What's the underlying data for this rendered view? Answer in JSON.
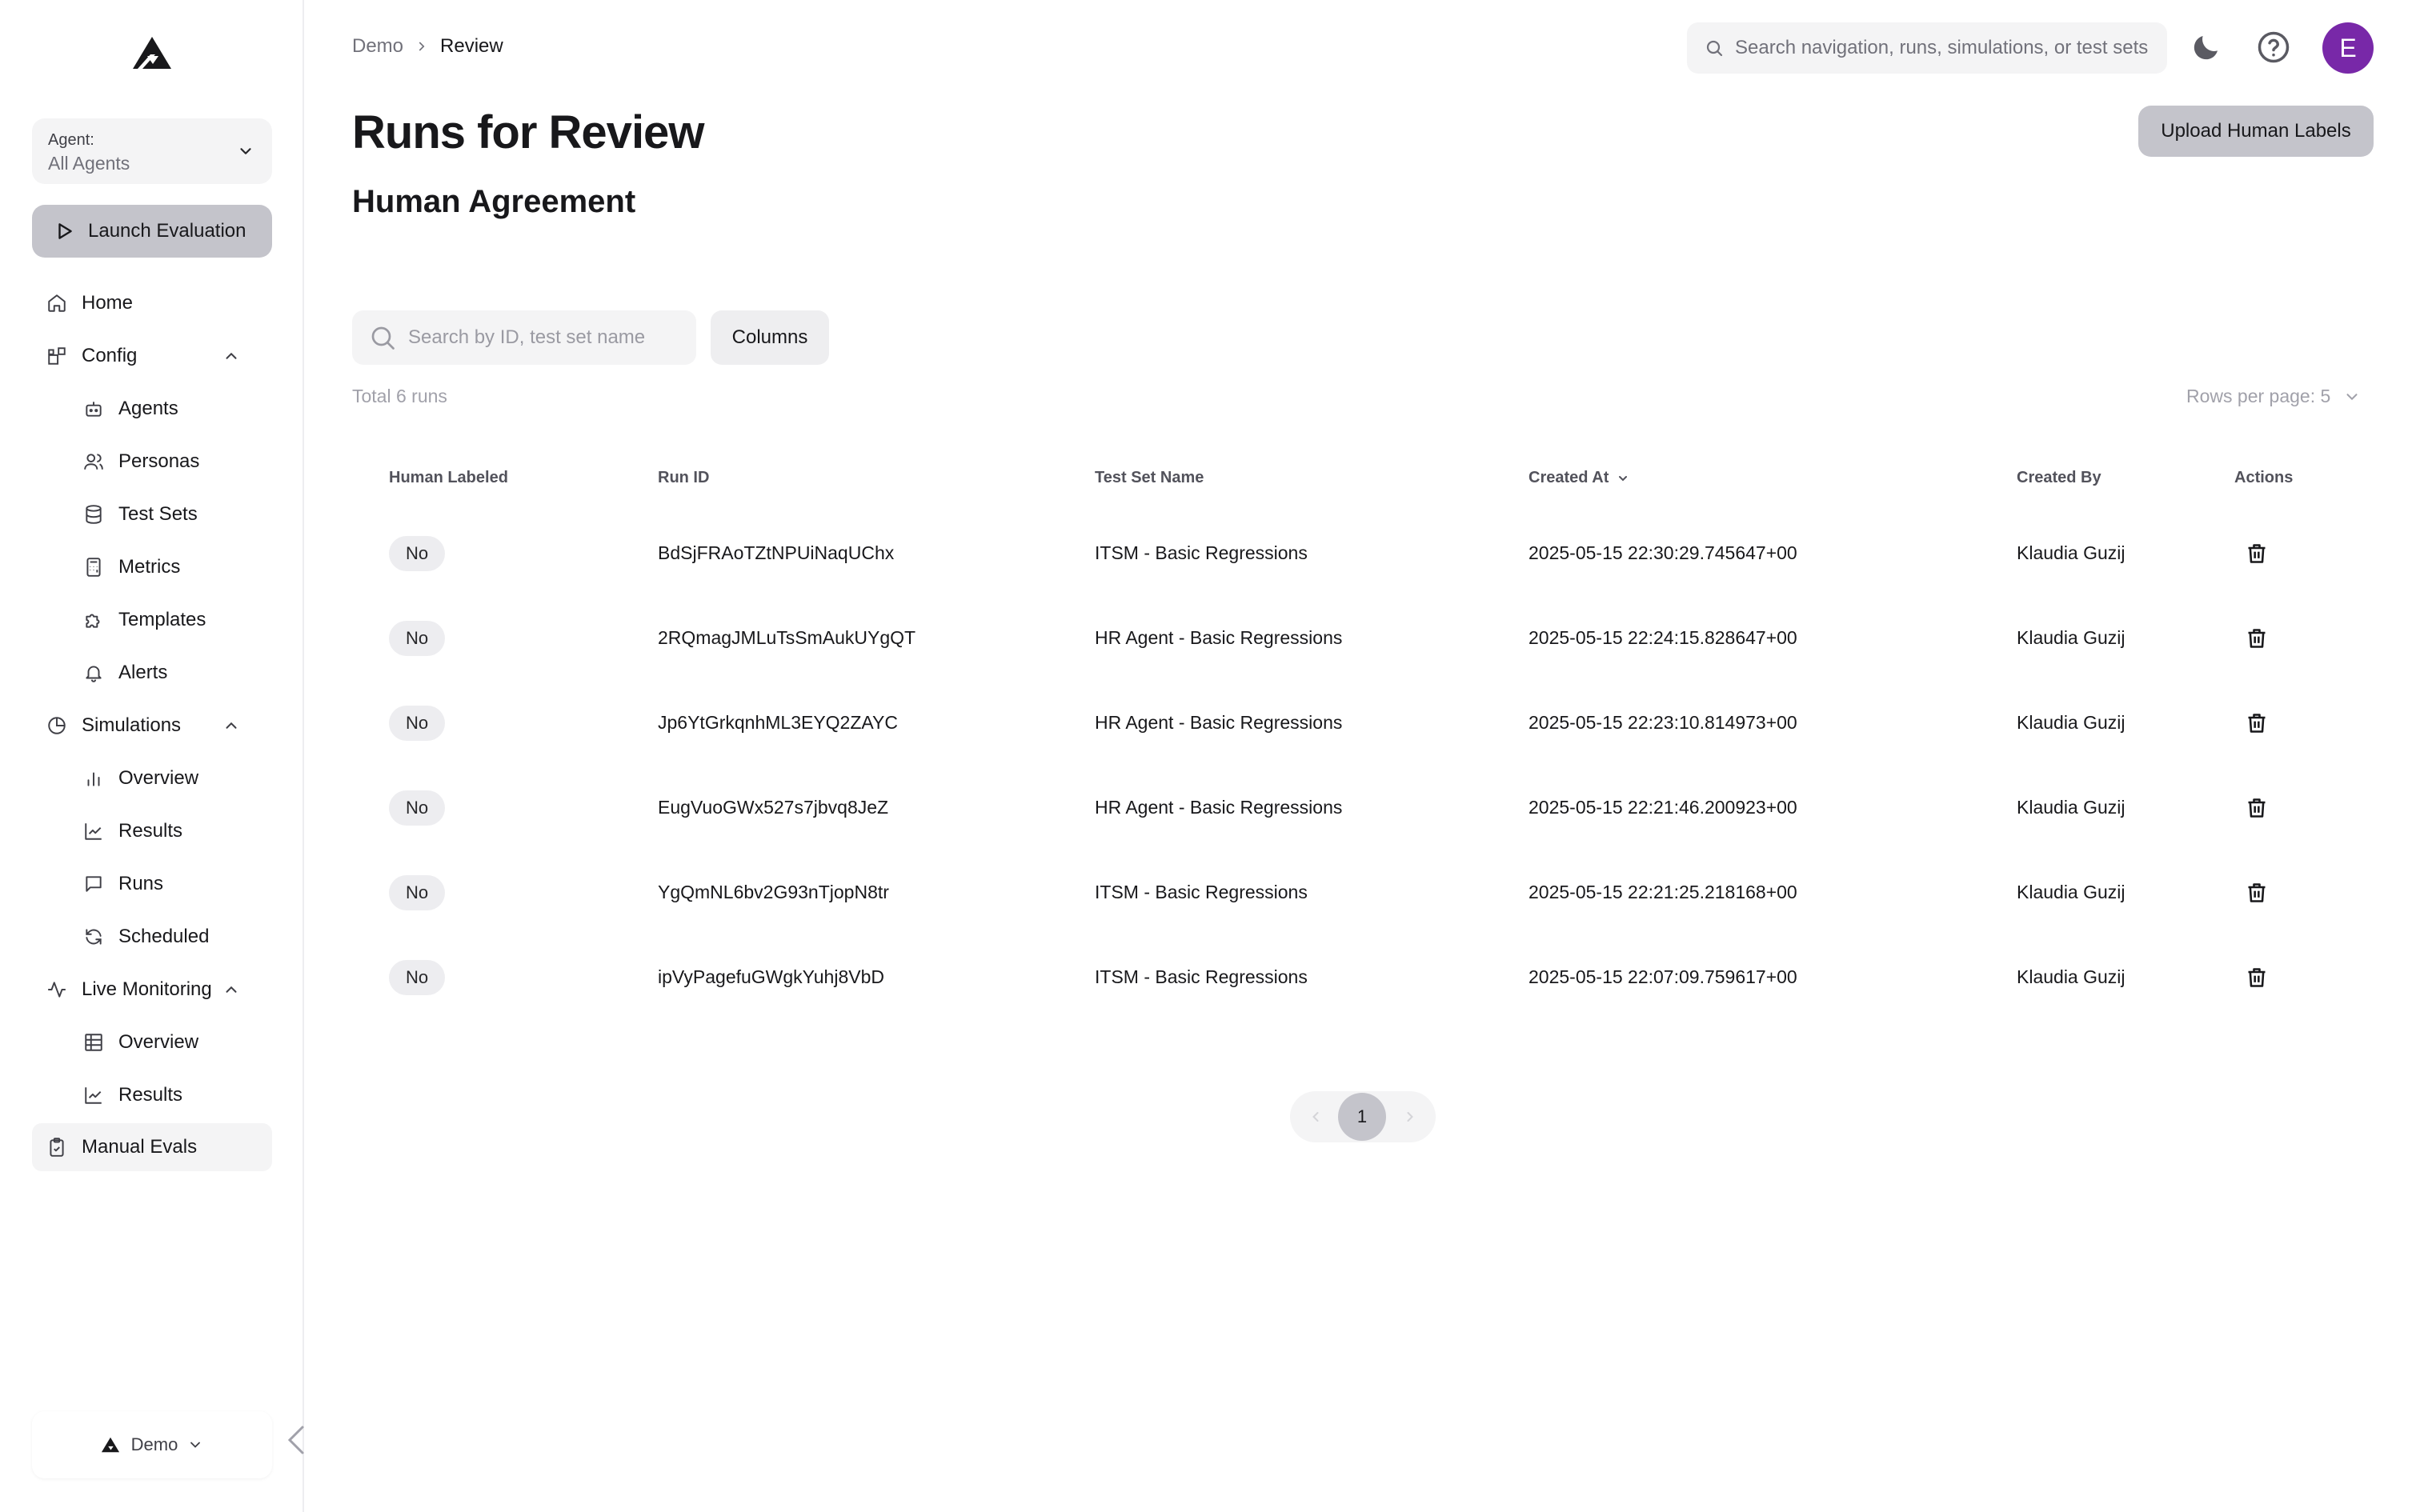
{
  "sidebar": {
    "agent_label": "Agent:",
    "agent_value": "All Agents",
    "launch_label": "Launch Evaluation",
    "items": {
      "home": "Home",
      "config": "Config",
      "agents": "Agents",
      "personas": "Personas",
      "test_sets": "Test Sets",
      "metrics": "Metrics",
      "templates": "Templates",
      "alerts": "Alerts",
      "simulations": "Simulations",
      "sim_overview": "Overview",
      "sim_results": "Results",
      "sim_runs": "Runs",
      "sim_scheduled": "Scheduled",
      "live_monitoring": "Live Monitoring",
      "live_overview": "Overview",
      "live_results": "Results",
      "manual_evals": "Manual Evals"
    },
    "workspace": "Demo"
  },
  "header": {
    "breadcrumb": [
      "Demo",
      "Review"
    ],
    "search_placeholder": "Search navigation, runs, simulations, or test sets",
    "avatar_initial": "E"
  },
  "main": {
    "title": "Runs for Review",
    "subtitle": "Human Agreement",
    "upload_label": "Upload Human Labels",
    "search_placeholder": "Search by ID, test set name",
    "columns_label": "Columns",
    "total": "Total 6 runs",
    "rows_per_page": "Rows per page: 5",
    "columns": [
      "Human Labeled",
      "Run ID",
      "Test Set Name",
      "Created At",
      "Created By",
      "Actions"
    ],
    "rows": [
      {
        "labeled": "No",
        "run_id": "BdSjFRAoTZtNPUiNaqUChx",
        "test_set": "ITSM - Basic Regressions",
        "created_at": "2025-05-15 22:30:29.745647+00",
        "created_by": "Klaudia Guzij"
      },
      {
        "labeled": "No",
        "run_id": "2RQmagJMLuTsSmAukUYgQT",
        "test_set": "HR Agent - Basic Regressions",
        "created_at": "2025-05-15 22:24:15.828647+00",
        "created_by": "Klaudia Guzij"
      },
      {
        "labeled": "No",
        "run_id": "Jp6YtGrkqnhML3EYQ2ZAYC",
        "test_set": "HR Agent - Basic Regressions",
        "created_at": "2025-05-15 22:23:10.814973+00",
        "created_by": "Klaudia Guzij"
      },
      {
        "labeled": "No",
        "run_id": "EugVuoGWx527s7jbvq8JeZ",
        "test_set": "HR Agent - Basic Regressions",
        "created_at": "2025-05-15 22:21:46.200923+00",
        "created_by": "Klaudia Guzij"
      },
      {
        "labeled": "No",
        "run_id": "YgQmNL6bv2G93nTjopN8tr",
        "test_set": "ITSM - Basic Regressions",
        "created_at": "2025-05-15 22:21:25.218168+00",
        "created_by": "Klaudia Guzij"
      },
      {
        "labeled": "No",
        "run_id": "ipVyPagefuGWgkYuhj8VbD",
        "test_set": "ITSM - Basic Regressions",
        "created_at": "2025-05-15 22:07:09.759617+00",
        "created_by": "Klaudia Guzij"
      }
    ],
    "current_page": "1"
  },
  "colors": {
    "avatar": "#7828a8",
    "primary_button": "#c4c4cb",
    "chip": "#ededf0"
  }
}
